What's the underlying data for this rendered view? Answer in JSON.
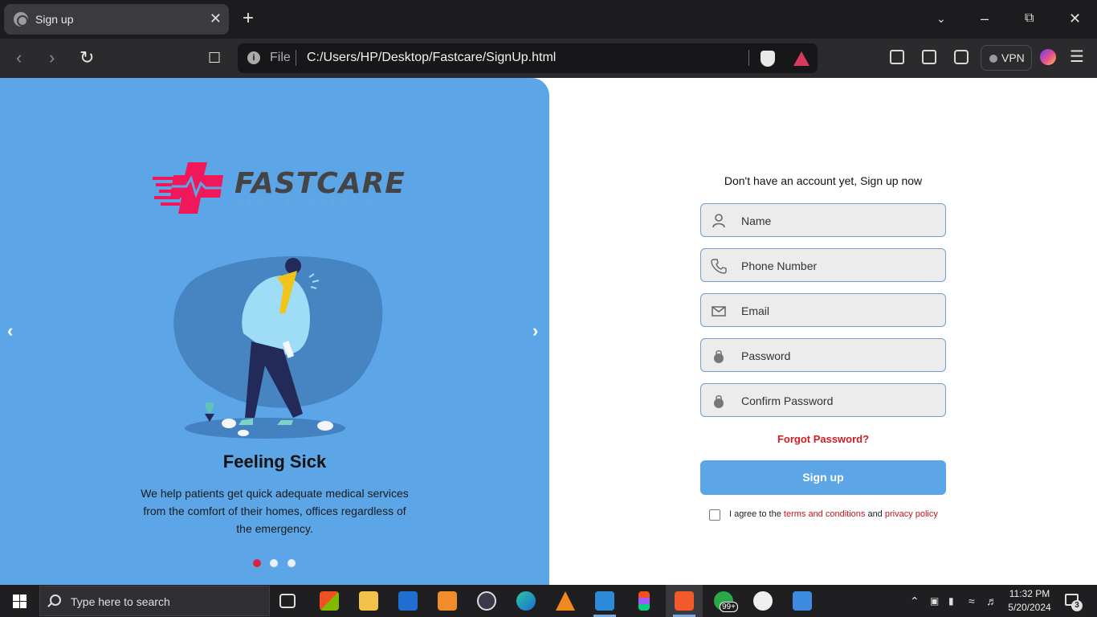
{
  "browser": {
    "tab_title": "Sign up",
    "new_tab_label": "+",
    "scheme_label": "File",
    "url": "C:/Users/HP/Desktop/Fastcare/SignUp.html",
    "vpn_label": "VPN"
  },
  "carousel": {
    "logo_text": "FASTCARE",
    "logo_subtext": "MEDICAL SERVICE",
    "slide_title": "Feeling Sick",
    "slide_text": "We help patients get quick adequate medical services from the comfort of their homes, offices regardless of the emergency.",
    "slide_count": 3,
    "active_slide": 1,
    "active_dot_color": "#d9253a",
    "panel_color": "#5ca6e8"
  },
  "form": {
    "heading": "Don't have an account yet, Sign up now",
    "fields": [
      {
        "placeholder": "Name",
        "icon": "user-icon"
      },
      {
        "placeholder": "Phone Number",
        "icon": "phone-icon"
      },
      {
        "placeholder": "Email",
        "icon": "mail-icon"
      },
      {
        "placeholder": "Password",
        "icon": "lock-icon"
      },
      {
        "placeholder": "Confirm Password",
        "icon": "lock-icon"
      }
    ],
    "forgot_label": "Forgot Password?",
    "submit_label": "Sign up",
    "agree_prefix": "I agree to the ",
    "terms_label": "terms and conditions",
    "agree_middle": " and ",
    "privacy_label": "privacy policy",
    "link_color": "#c8141c"
  },
  "taskbar": {
    "search_placeholder": "Type here to search",
    "time": "11:32 PM",
    "date": "5/20/2024",
    "whatsapp_badge": "99+",
    "notification_count": "3"
  }
}
